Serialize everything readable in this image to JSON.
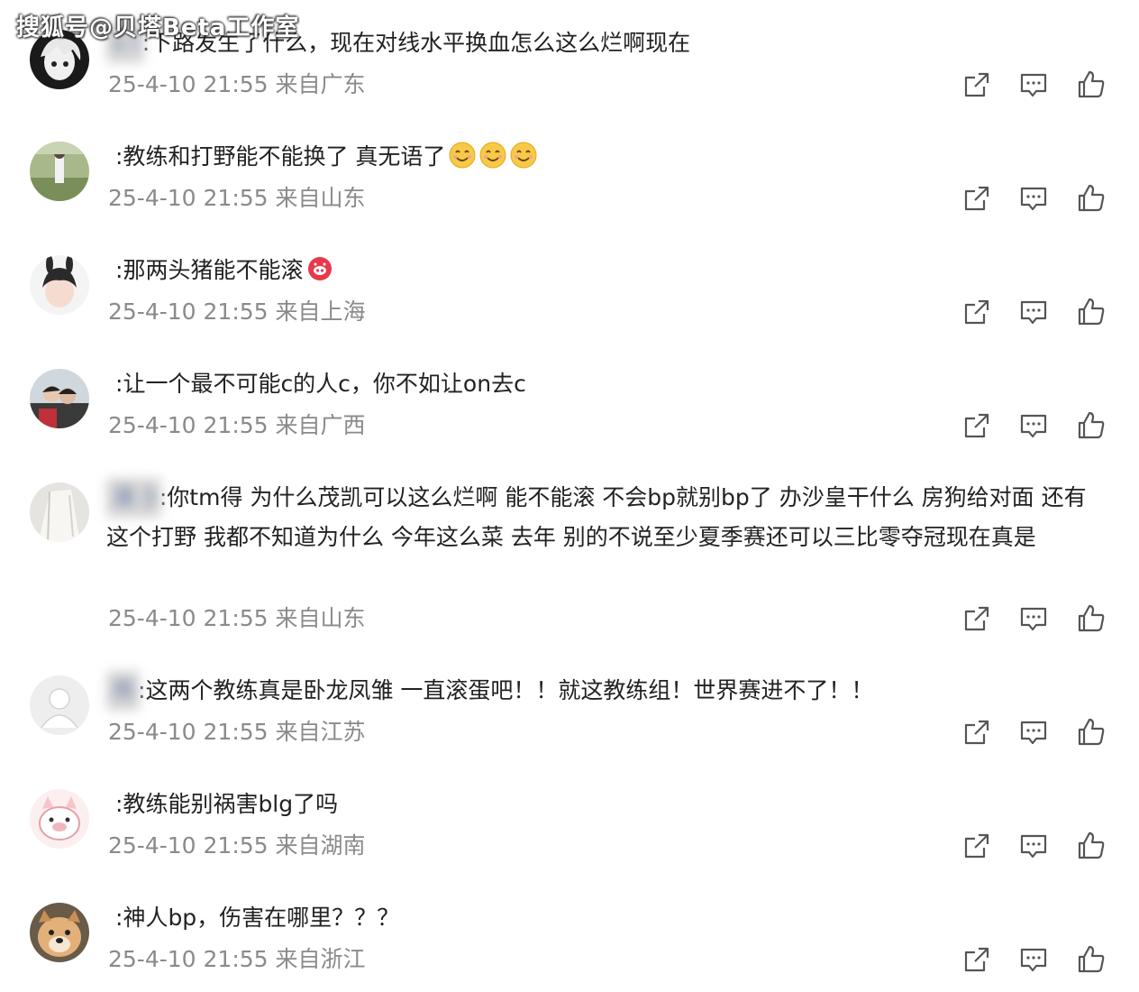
{
  "watermark": "搜狐号@贝塔Beta工作室",
  "comments": [
    {
      "user": "x                l",
      "sep": ":",
      "text": "下路发生了什么，现在对线水平换血怎么这么烂啊现在",
      "time": "25-4-10 21:55",
      "location": "来自广东",
      "emoji": []
    },
    {
      "user": "                           ",
      "sep": ":",
      "text": "教练和打野能不能换了   真无语了",
      "time": "25-4-10 21:55",
      "location": "来自山东",
      "emoji": [
        "smile-emoji",
        "smile-emoji",
        "smile-emoji"
      ]
    },
    {
      "user": "                    ",
      "sep": ":",
      "text": "那两头猪能不能滚",
      "time": "25-4-10 21:55",
      "location": "来自上海",
      "emoji": [
        "pig-emoji"
      ]
    },
    {
      "user": "                       ",
      "sep": ":",
      "text": "让一个最不可能c的人c，你不如让on去c",
      "time": "25-4-10 21:55",
      "location": "来自广西",
      "emoji": []
    },
    {
      "user": "涌      3",
      "sep": ":",
      "text": "你tm得 为什么茂凯可以这么烂啊 能不能滚 不会bp就别bp了 办沙皇干什么  房狗给对面  还有这个打野 我都不知道为什么 今年这么菜  去年 别的不说至少夏季赛还可以三比零夺冠现在真是",
      "time": "25-4-10 21:55",
      "location": "来自山东",
      "emoji": []
    },
    {
      "user": "用                       ",
      "sep": ":",
      "text": "这两个教练真是卧龙凤雏  一直滚蛋吧！！就这教练组！世界赛进不了！！",
      "time": "25-4-10 21:55",
      "location": "来自江苏",
      "emoji": []
    },
    {
      "user": "                ",
      "sep": ":",
      "text": "教练能别祸害blg了吗",
      "time": "25-4-10 21:55",
      "location": "来自湖南",
      "emoji": []
    },
    {
      "user": "                 ",
      "sep": ":",
      "text": "神人bp，伤害在哪里？？？",
      "time": "25-4-10 21:55",
      "location": "来自浙江",
      "emoji": []
    }
  ],
  "icons": {
    "share": "share-icon",
    "reply": "comment-icon",
    "like": "thumbs-up-icon"
  },
  "colors": {
    "text": "#222222",
    "meta": "#8a8a8a",
    "icon": "#555555"
  }
}
